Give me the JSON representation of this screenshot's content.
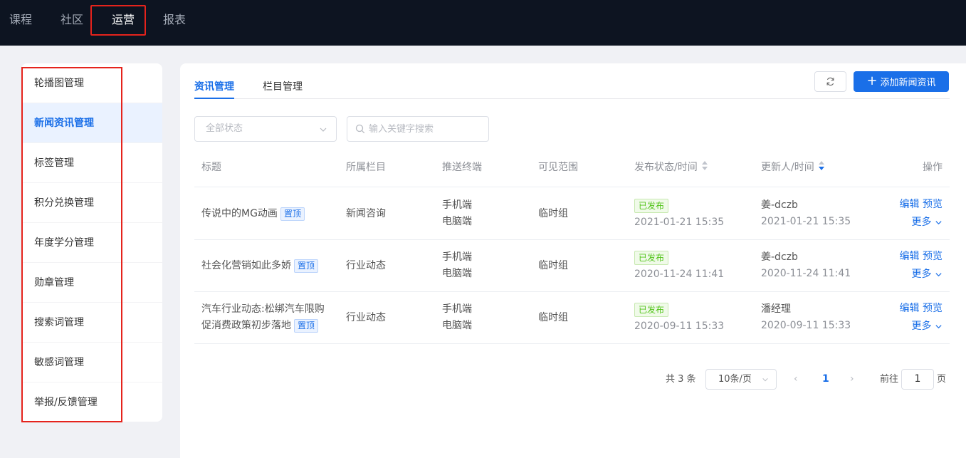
{
  "topnav": {
    "items": [
      "课程",
      "社区",
      "运营",
      "报表"
    ],
    "active_index": 2
  },
  "sidebar": {
    "items": [
      "轮播图管理",
      "新闻资讯管理",
      "标签管理",
      "积分兑换管理",
      "年度学分管理",
      "勋章管理",
      "搜索词管理",
      "敏感词管理",
      "举报/反馈管理"
    ],
    "active_index": 1
  },
  "tabs": {
    "items": [
      "资讯管理",
      "栏目管理"
    ],
    "active_index": 0
  },
  "toolbar": {
    "refresh_icon": "refresh-icon",
    "add_label": "添加新闻资讯"
  },
  "filters": {
    "status_placeholder": "全部状态",
    "search_placeholder": "输入关键字搜索"
  },
  "table": {
    "headers": [
      "标题",
      "所属栏目",
      "推送终端",
      "可见范围",
      "发布状态/时间",
      "更新人/时间",
      "操作"
    ],
    "rows": [
      {
        "title_line1": "传说中的MG动画",
        "title_line2": "",
        "tag": "置顶",
        "column": "新闻咨询",
        "terminal1": "手机端",
        "terminal2": "电脑端",
        "scope": "临时组",
        "status": "已发布",
        "publish_time": "2021-01-21 15:35",
        "updater": "姜-dczb",
        "update_time": "2021-01-21 15:35",
        "op_edit": "编辑",
        "op_preview": "预览",
        "op_more": "更多"
      },
      {
        "title_line1": "社会化营销如此多娇",
        "title_line2": "",
        "tag": "置顶",
        "column": "行业动态",
        "terminal1": "手机端",
        "terminal2": "电脑端",
        "scope": "临时组",
        "status": "已发布",
        "publish_time": "2020-11-24 11:41",
        "updater": "姜-dczb",
        "update_time": "2020-11-24 11:41",
        "op_edit": "编辑",
        "op_preview": "预览",
        "op_more": "更多"
      },
      {
        "title_line1": "汽车行业动态:松绑汽车限购",
        "title_line2": "促消费政策初步落地",
        "tag": "置顶",
        "column": "行业动态",
        "terminal1": "手机端",
        "terminal2": "电脑端",
        "scope": "临时组",
        "status": "已发布",
        "publish_time": "2020-09-11 15:33",
        "updater": "潘经理",
        "update_time": "2020-09-11 15:33",
        "op_edit": "编辑",
        "op_preview": "预览",
        "op_more": "更多"
      }
    ]
  },
  "pagination": {
    "total": "共 3 条",
    "page_size": "10条/页",
    "prev": "‹",
    "current": "1",
    "next": "›",
    "goto_prefix": "前往",
    "goto_value": "1",
    "goto_suffix": "页"
  },
  "colors": {
    "accent": "#1a6fe8",
    "highlight_box": "#e5231c",
    "nav_bg": "#0d1421",
    "published": "#52c41a"
  }
}
